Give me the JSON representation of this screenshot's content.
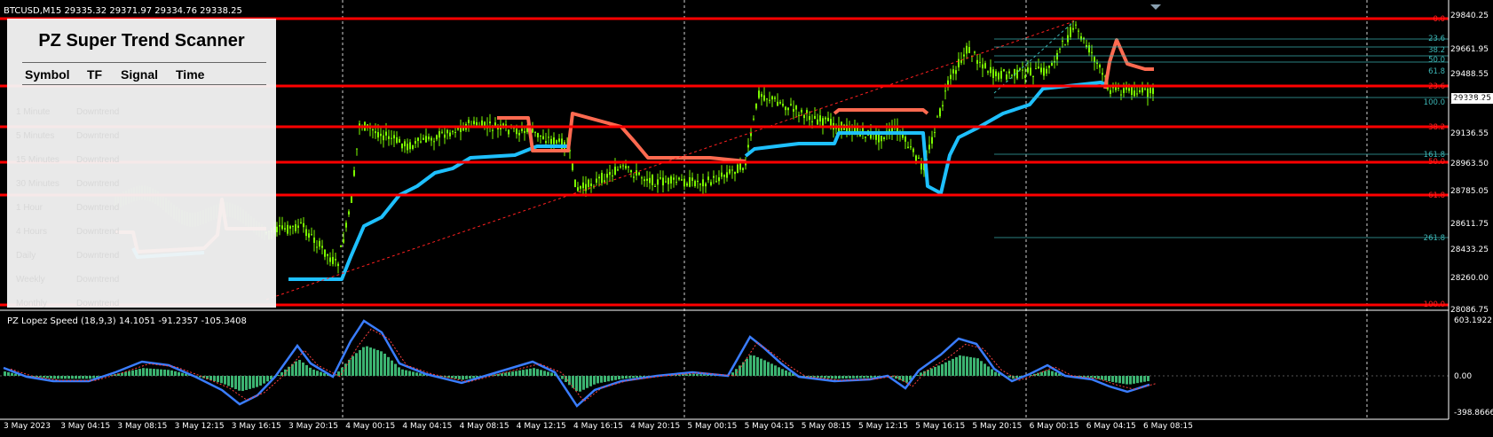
{
  "window": {
    "symbol_header": "BTCUSD,M15  29335.32 29371.97 29334.76 29338.25",
    "indicator_header": "PZ Lopez Speed (18,9,3) 14.1051 -91.2357 -105.3408",
    "current_price": "29338.25"
  },
  "price_axis": [
    "29840.25",
    "29661.95",
    "29488.55",
    "29310.05",
    "29136.55",
    "28963.50",
    "28785.05",
    "28611.75",
    "28433.25",
    "28260.00",
    "28086.75"
  ],
  "indicator_axis": [
    "603.1922",
    "0.00",
    "-398.8666"
  ],
  "time_axis": [
    "3 May 2023",
    "3 May 04:15",
    "3 May 08:15",
    "3 May 12:15",
    "3 May 16:15",
    "3 May 20:15",
    "4 May 00:15",
    "4 May 04:15",
    "4 May 08:15",
    "4 May 12:15",
    "4 May 16:15",
    "4 May 20:15",
    "5 May 00:15",
    "5 May 04:15",
    "5 May 08:15",
    "5 May 12:15",
    "5 May 16:15",
    "5 May 20:15",
    "6 May 00:15",
    "6 May 04:15",
    "6 May 08:15"
  ],
  "fib_levels": [
    {
      "label": "0.0",
      "color": "red"
    },
    {
      "label": "23.6",
      "color": "teal"
    },
    {
      "label": "38.2",
      "color": "teal"
    },
    {
      "label": "50.0",
      "color": "teal"
    },
    {
      "label": "61.8",
      "color": "teal"
    },
    {
      "label": "23.6",
      "color": "red"
    },
    {
      "label": "100.0",
      "color": "teal"
    },
    {
      "label": "38.2",
      "color": "red"
    },
    {
      "label": "161.8",
      "color": "teal"
    },
    {
      "label": "50.0",
      "color": "red"
    },
    {
      "label": "61.8",
      "color": "red"
    },
    {
      "label": "261.8",
      "color": "teal"
    },
    {
      "label": "100.0",
      "color": "red"
    }
  ],
  "scanner": {
    "title": "PZ Super Trend Scanner",
    "columns": [
      "Symbol",
      "TF",
      "Signal",
      "Time"
    ],
    "rows": [
      {
        "tf": "1 Minute",
        "signal": "Downtrend"
      },
      {
        "tf": "5 Minutes",
        "signal": "Downtrend"
      },
      {
        "tf": "15 Minutes",
        "signal": "Downtrend"
      },
      {
        "tf": "30 Minutes",
        "signal": "Downtrend"
      },
      {
        "tf": "1 Hour",
        "signal": "Downtrend"
      },
      {
        "tf": "4 Hours",
        "signal": "Downtrend"
      },
      {
        "tf": "Daily",
        "signal": "Downtrend"
      },
      {
        "tf": "Weekly",
        "signal": "Downtrend"
      },
      {
        "tf": "Monthly",
        "signal": "Downtrend"
      }
    ]
  },
  "colors": {
    "background": "#000000",
    "bull_candle": "#7CFC00",
    "supertrend_up": "#1ec0ff",
    "supertrend_down": "#ff6a50",
    "horizontal_line": "#ff0000",
    "fib_teal": "#3cb7b7",
    "histogram": "#3cb371",
    "speed_line": "#3a7dff"
  }
}
